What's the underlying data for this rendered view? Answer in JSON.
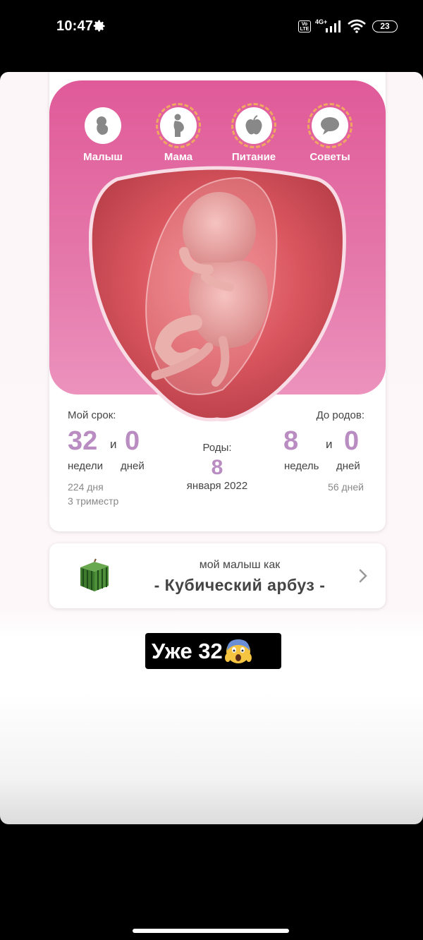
{
  "status_bar": {
    "time": "10:47",
    "volte": "Vo LTE",
    "network": "4G+",
    "battery": "23"
  },
  "tabs": [
    {
      "label": "Малыш"
    },
    {
      "label": "Мама"
    },
    {
      "label": "Питание"
    },
    {
      "label": "Советы"
    }
  ],
  "stats": {
    "my_term_label": "Мой срок:",
    "weeks_value": "32",
    "and1": "и",
    "days_value": "0",
    "weeks_label": "недели",
    "days_label": "дней",
    "total_days": "224 дня",
    "trimester": "3 триместр",
    "birth_label": "Роды:",
    "birth_day": "8",
    "birth_month_year": "января 2022",
    "until_label": "До родов:",
    "until_weeks_value": "8",
    "and2": "и",
    "until_days_value": "0",
    "until_weeks_label": "недель",
    "until_days_label": "дней",
    "until_total_days": "56 дней"
  },
  "fruit_card": {
    "subtitle": "мой малыш как",
    "name": "- Кубический арбуз -"
  },
  "caption": {
    "text": "Уже 32"
  },
  "colors": {
    "pink": "#e05a99",
    "lilac": "#b98dc2",
    "dash": "#f0a860"
  }
}
